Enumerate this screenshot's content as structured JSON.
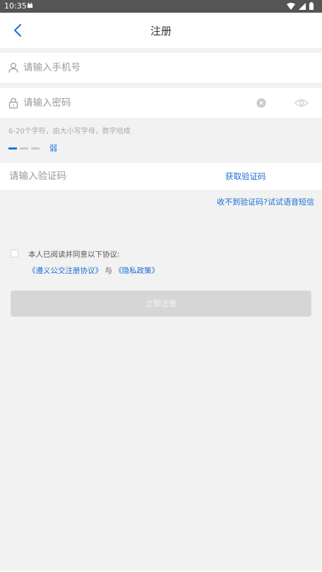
{
  "status_bar": {
    "time": "10:35"
  },
  "header": {
    "title": "注册"
  },
  "form": {
    "phone_placeholder": "请输入手机号",
    "password_placeholder": "请输入密码",
    "password_hint": "6-20个字符，由大小写字母，数字组成",
    "strength_label": "弱",
    "strength_level": 0.33,
    "code_placeholder": "请输入验证码",
    "get_code_label": "获取验证码",
    "voice_code_link": "收不到验证码?试试语音短信"
  },
  "agreement": {
    "text": "本人已阅读并同意以下协议:",
    "link1": "《遵义公交注册协议》",
    "separator": "与",
    "link2": "《隐私政策》",
    "checked": false
  },
  "submit": {
    "label": "立即注册"
  },
  "colors": {
    "accent": "#1a6fd0",
    "button_disabled": "#d6d6d6",
    "background": "#f2f2f2"
  },
  "icons": [
    "back-icon",
    "user-icon",
    "lock-icon",
    "clear-icon",
    "eye-icon"
  ]
}
